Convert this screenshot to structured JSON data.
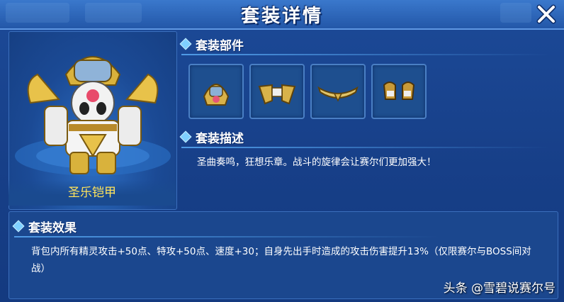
{
  "dialog": {
    "title": "套装详情",
    "close_icon": "close-icon"
  },
  "suit": {
    "name": "圣乐铠甲"
  },
  "parts_section": {
    "heading": "套装部件",
    "items": [
      "helmet-icon",
      "shoulder-armor-icon",
      "belt-icon",
      "gauntlet-icon"
    ]
  },
  "description_section": {
    "heading": "套装描述",
    "text": "圣曲奏鸣，狂想乐章。战斗的旋律会让赛尔们更加强大！"
  },
  "effect_section": {
    "heading": "套装效果",
    "text": "背包内所有精灵攻击+50点、特攻+50点、速度+30；自身先出手时造成的攻击伤害提升13%（仅限赛尔与BOSS间对战）"
  },
  "watermark": {
    "text": "头条 @雪碧说赛尔号"
  },
  "colors": {
    "accent": "#7fd0ff",
    "name_gold": "#ffe45c",
    "panel_blue": "#1a3f86"
  }
}
